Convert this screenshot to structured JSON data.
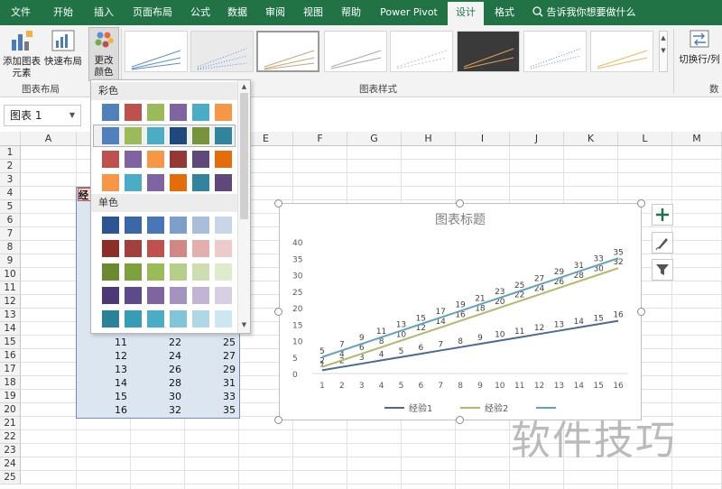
{
  "tabs": [
    "文件",
    "开始",
    "插入",
    "页面布局",
    "公式",
    "数据",
    "审阅",
    "视图",
    "帮助",
    "Power Pivot",
    "设计",
    "格式"
  ],
  "tell_me": "告诉我你想要做什么",
  "ribbon": {
    "add_chart_element": "添加图表\n元素",
    "quick_layout": "快速布局",
    "change_colors": "更改\n颜色",
    "group_chart_layout": "图表布局",
    "group_chart_styles": "图表样式",
    "switch_row_col": "切换行/列",
    "group_data_partial": "数据"
  },
  "name_box": "图表 1",
  "columns": [
    "A",
    "B",
    "C",
    "D",
    "E",
    "F",
    "G",
    "H",
    "I",
    "J",
    "K",
    "L",
    "M"
  ],
  "rows": [
    "1",
    "2",
    "3",
    "4",
    "5",
    "6",
    "7",
    "8",
    "9",
    "10",
    "11",
    "12",
    "13",
    "14",
    "15",
    "16",
    "17",
    "18",
    "19",
    "20",
    "21",
    "22",
    "23",
    "24",
    "25"
  ],
  "table_header_partial": "经",
  "table_rows": [
    {
      "row": "15",
      "b": "11",
      "c": "22",
      "d": "25"
    },
    {
      "row": "16",
      "b": "12",
      "c": "24",
      "d": "27"
    },
    {
      "row": "17",
      "b": "13",
      "c": "26",
      "d": "29"
    },
    {
      "row": "18",
      "b": "14",
      "c": "28",
      "d": "31"
    },
    {
      "row": "19",
      "b": "15",
      "c": "30",
      "d": "33"
    },
    {
      "row": "20",
      "b": "16",
      "c": "32",
      "d": "35"
    }
  ],
  "color_dropdown": {
    "colorful_label": "彩色",
    "monochrome_label": "单色",
    "colorful_rows": [
      [
        "#4f81bd",
        "#c0504d",
        "#9bbb59",
        "#8064a2",
        "#4bacc6",
        "#f79646"
      ],
      [
        "#4f81bd",
        "#9bbb59",
        "#4bacc6",
        "#1f497d",
        "#77933c",
        "#31849b"
      ],
      [
        "#c0504d",
        "#8064a2",
        "#f79646",
        "#953735",
        "#5f497a",
        "#e46c0a"
      ],
      [
        "#f79646",
        "#4bacc6",
        "#8064a2",
        "#e46c0a",
        "#31849b",
        "#5f497a"
      ]
    ],
    "mono_rows": [
      [
        "#2e5593",
        "#3a67a8",
        "#4876b6",
        "#7e9fcb",
        "#a9bedd",
        "#c9d6ea"
      ],
      [
        "#8e2c29",
        "#a3403d",
        "#c0504d",
        "#d28785",
        "#e2afad",
        "#edcbca"
      ],
      [
        "#6b8a2f",
        "#7fa13d",
        "#9bbb59",
        "#b6cf88",
        "#cddfb0",
        "#dfebcd"
      ],
      [
        "#4c3975",
        "#5d4a8a",
        "#8064a2",
        "#a592c0",
        "#c1b5d5",
        "#d8cfe5"
      ],
      [
        "#2a8299",
        "#379cb5",
        "#4bacc6",
        "#82c5d8",
        "#aed8e5",
        "#cce7ef"
      ]
    ],
    "selected_row_index": 1
  },
  "chart_data": {
    "type": "line",
    "title": "图表标题",
    "x": [
      1,
      2,
      3,
      4,
      5,
      6,
      7,
      8,
      9,
      10,
      11,
      12,
      13,
      14,
      15,
      16
    ],
    "ylim": [
      0,
      40
    ],
    "yticks": [
      0,
      5,
      10,
      15,
      20,
      25,
      30,
      35,
      40
    ],
    "grid": false,
    "legend": "bottom",
    "series": [
      {
        "name": "经验1",
        "color": "#4a6b94",
        "values": [
          1,
          2,
          3,
          4,
          5,
          6,
          7,
          8,
          9,
          10,
          11,
          12,
          13,
          14,
          15,
          16
        ]
      },
      {
        "name": "经验2",
        "color": "#b3b86a",
        "values": [
          2,
          4,
          6,
          8,
          10,
          12,
          14,
          16,
          18,
          20,
          22,
          24,
          26,
          28,
          30,
          32
        ]
      },
      {
        "name": "",
        "color": "#5fa3bd",
        "values": [
          5,
          7,
          9,
          11,
          13,
          15,
          17,
          19,
          21,
          23,
          25,
          27,
          29,
          31,
          33,
          35
        ]
      }
    ]
  },
  "watermark": "软件技巧"
}
